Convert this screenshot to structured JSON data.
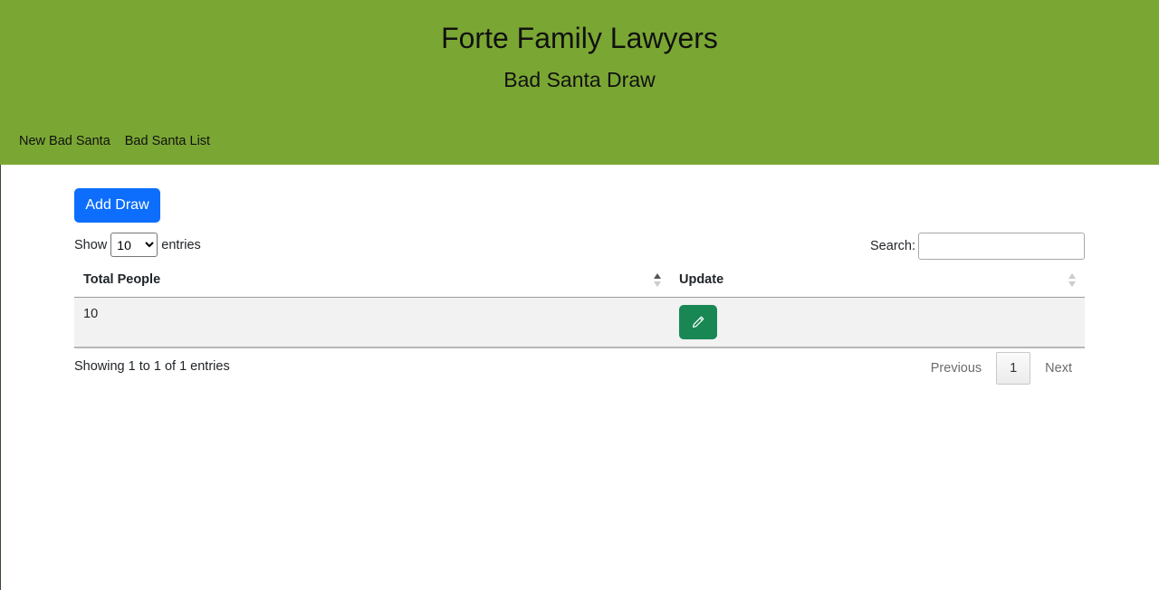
{
  "header": {
    "title": "Forte Family Lawyers",
    "subtitle": "Bad Santa Draw",
    "background": "#7aa733"
  },
  "nav": {
    "items": [
      {
        "label": "New Bad Santa"
      },
      {
        "label": "Bad Santa List"
      }
    ]
  },
  "toolbar": {
    "add_label": "Add Draw",
    "add_color": "#0d6efd"
  },
  "table_controls": {
    "show_label": "Show",
    "page_length": "10",
    "page_length_options": [
      "10"
    ],
    "entries_label": "entries",
    "search_label": "Search:",
    "search_value": ""
  },
  "table": {
    "columns": [
      "Total People",
      "Update"
    ],
    "rows": [
      {
        "total_people": "10",
        "update_icon": "pencil-icon"
      }
    ]
  },
  "footer": {
    "info": "Showing 1 to 1 of 1 entries",
    "previous_label": "Previous",
    "current_page": "1",
    "next_label": "Next"
  },
  "colors": {
    "edit_button": "#198754"
  }
}
